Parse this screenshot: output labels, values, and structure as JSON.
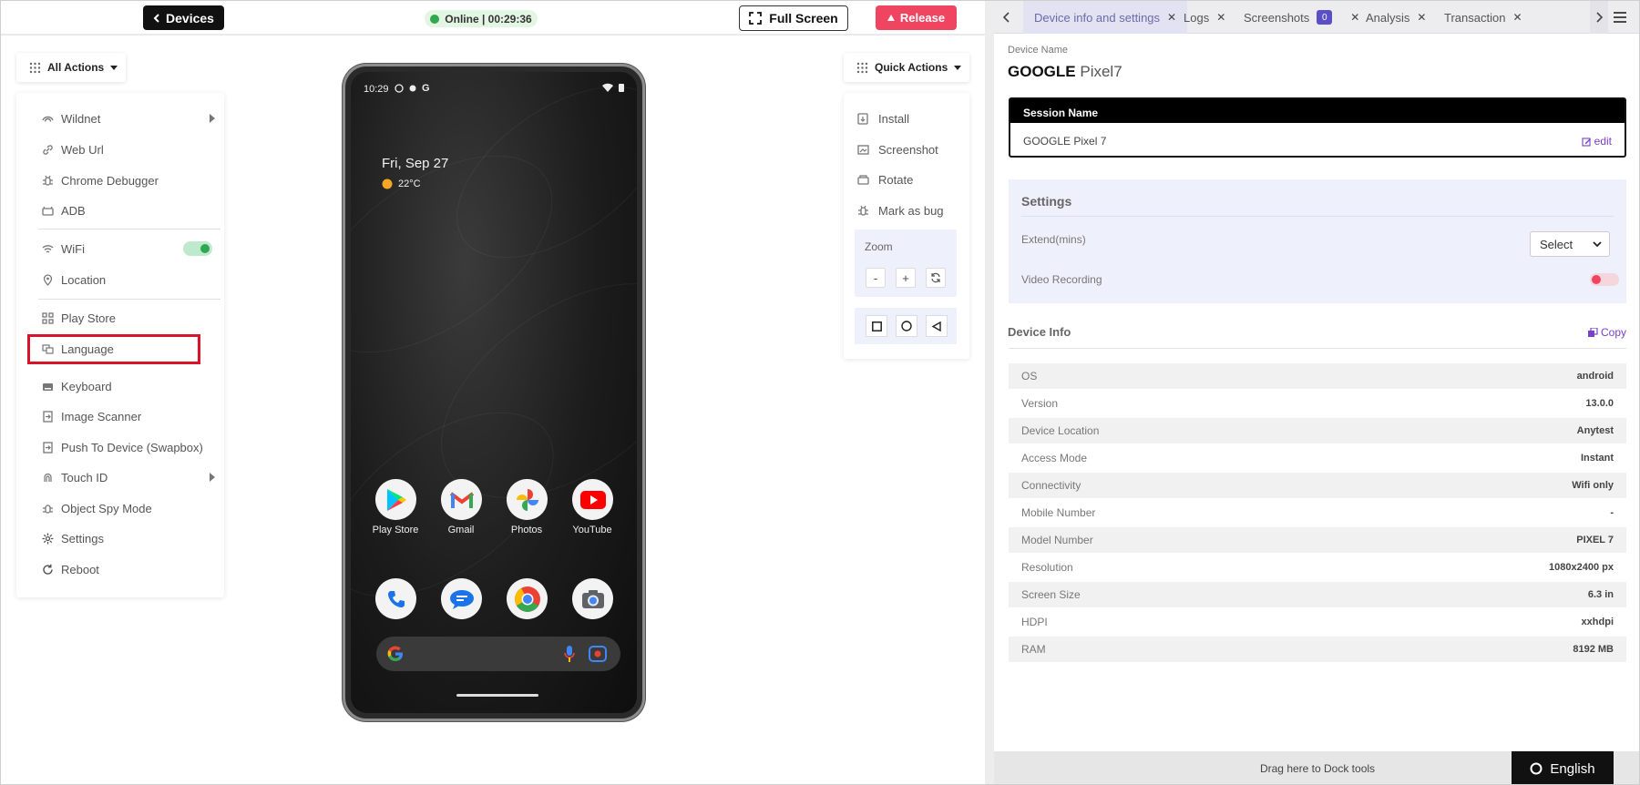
{
  "topbar": {
    "devices_label": "Devices",
    "status": "Online | 00:29:36",
    "fullscreen_label": "Full Screen",
    "release_label": "Release"
  },
  "all_actions": {
    "label": "All Actions",
    "items": [
      {
        "label": "Wildnet",
        "icon": "network-icon",
        "submenu": true
      },
      {
        "label": "Web Url",
        "icon": "link-icon"
      },
      {
        "label": "Chrome Debugger",
        "icon": "bug-icon"
      },
      {
        "label": "ADB",
        "icon": "adb-icon"
      },
      {
        "label": "WiFi",
        "icon": "wifi-icon",
        "toggle": "on"
      },
      {
        "label": "Location",
        "icon": "location-pin-icon"
      },
      {
        "label": "Play Store",
        "icon": "apps-icon"
      },
      {
        "label": "Language",
        "icon": "translate-icon"
      },
      {
        "label": "Keyboard",
        "icon": "keyboard-icon"
      },
      {
        "label": "Image Scanner",
        "icon": "image-scan-icon"
      },
      {
        "label": "Push To Device (Swapbox)",
        "icon": "push-icon"
      },
      {
        "label": "Touch ID",
        "icon": "fingerprint-icon",
        "submenu": true
      },
      {
        "label": "Object Spy Mode",
        "icon": "spy-icon"
      },
      {
        "label": "Settings",
        "icon": "gear-icon"
      },
      {
        "label": "Reboot",
        "icon": "reboot-icon"
      }
    ]
  },
  "phone": {
    "time": "10:29",
    "date": "Fri, Sep 27",
    "weather": "22°C",
    "apps_row1": [
      "Play Store",
      "Gmail",
      "Photos",
      "YouTube"
    ]
  },
  "quick_actions": {
    "label": "Quick Actions",
    "items": [
      {
        "label": "Install",
        "icon": "install-icon"
      },
      {
        "label": "Screenshot",
        "icon": "screenshot-icon"
      },
      {
        "label": "Rotate",
        "icon": "rotate-icon"
      },
      {
        "label": "Mark as bug",
        "icon": "bug-icon"
      }
    ],
    "zoom_label": "Zoom",
    "zoom_minus": "-",
    "zoom_plus": "+"
  },
  "tabs": [
    {
      "label": "Device info and settings",
      "active": true
    },
    {
      "label": "Logs"
    },
    {
      "label": "Screenshots",
      "badge": "0"
    },
    {
      "label": "Analysis"
    },
    {
      "label": "Transaction"
    }
  ],
  "device": {
    "name_label": "Device Name",
    "brand": "GOOGLE",
    "model": "Pixel7",
    "session_header": "Session Name",
    "session_value": "GOOGLE Pixel 7",
    "edit_label": "edit"
  },
  "settings": {
    "title": "Settings",
    "extend_label": "Extend(mins)",
    "extend_value": "Select",
    "video_label": "Video Recording",
    "video_on": false
  },
  "device_info": {
    "title": "Device Info",
    "copy_label": "Copy",
    "rows": [
      {
        "k": "OS",
        "v": "android"
      },
      {
        "k": "Version",
        "v": "13.0.0"
      },
      {
        "k": "Device Location",
        "v": "Anytest"
      },
      {
        "k": "Access Mode",
        "v": "Instant"
      },
      {
        "k": "Connectivity",
        "v": "Wifi only"
      },
      {
        "k": "Mobile Number",
        "v": "-"
      },
      {
        "k": "Model Number",
        "v": "PIXEL 7"
      },
      {
        "k": "Resolution",
        "v": "1080x2400 px"
      },
      {
        "k": "Screen Size",
        "v": "6.3 in"
      },
      {
        "k": "HDPI",
        "v": "xxhdpi"
      },
      {
        "k": "RAM",
        "v": "8192 MB"
      }
    ]
  },
  "footer": {
    "dock_label": "Drag here to Dock tools",
    "language_label": "English"
  }
}
